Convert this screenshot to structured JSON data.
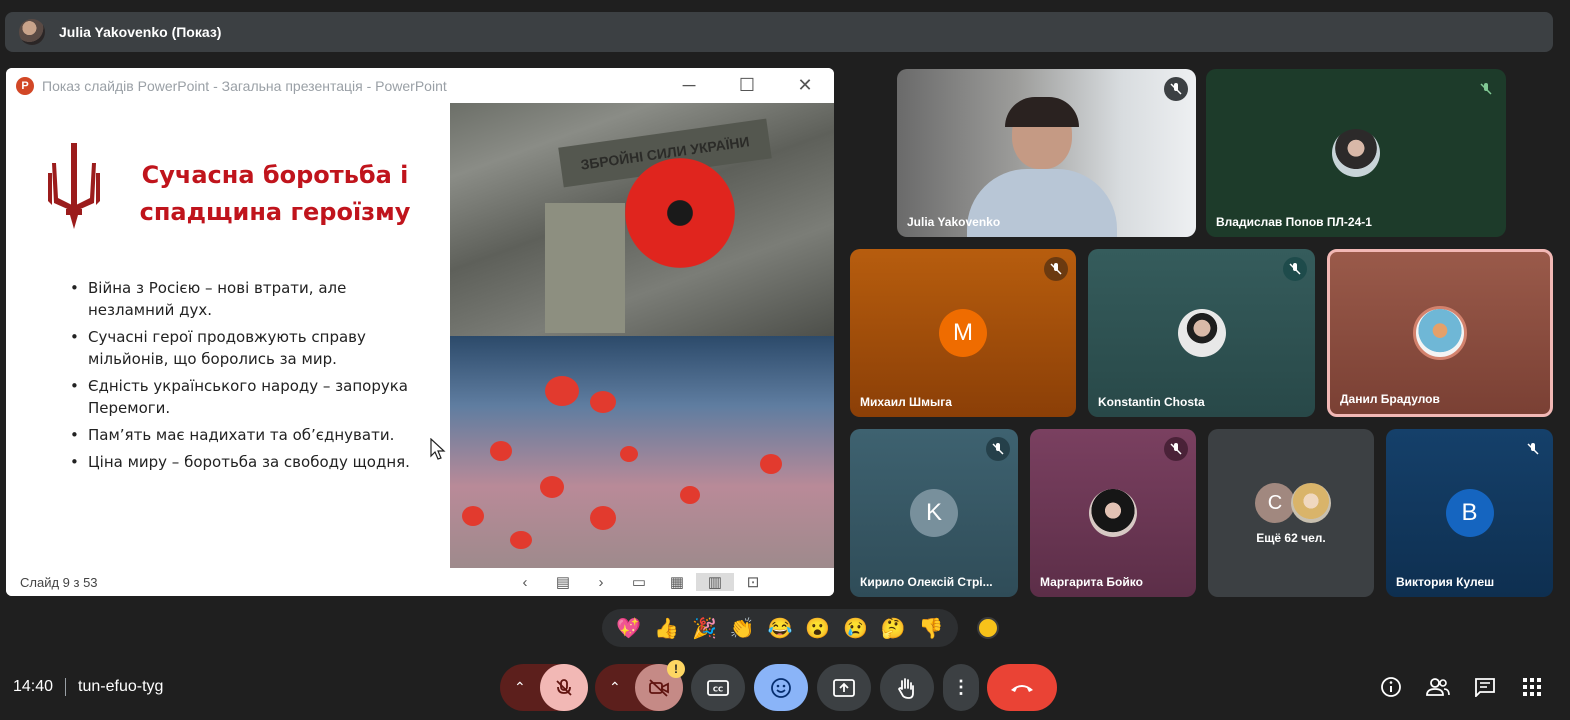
{
  "top_bar": {
    "presenter": "Julia Yakovenko (Показ)"
  },
  "ppt_window": {
    "title": "Показ слайдів PowerPoint  -  Загальна презентація - PowerPoint",
    "app_icon": "P",
    "slide_title": "Сучасна боротьба і спадщина героїзму",
    "bullets": [
      "Війна з Росією – нові втрати, але незламний дух.",
      "Сучасні герої продовжують справу мільйонів, що боролись за мир.",
      "Єдність українського народу – запорука Перемоги.",
      "Пам’ять має надихати та об’єднувати.",
      "Ціна миру – боротьба за свободу щодня."
    ],
    "patch_text": "ЗБРОЙНІ СИЛИ УКРАЇНИ",
    "status": "Слайд 9 з 53"
  },
  "participants": [
    {
      "name": "Julia Yakovenko",
      "initial": ""
    },
    {
      "name": "Владислав Попов ПЛ-24-1",
      "initial": ""
    },
    {
      "name": "Михаил Шмыга",
      "initial": "M"
    },
    {
      "name": "Konstantin Chosta",
      "initial": ""
    },
    {
      "name": "Данил Брадулов",
      "initial": ""
    },
    {
      "name": "Кирило Олексій Стрі...",
      "initial": "K"
    },
    {
      "name": "Маргарита Бойко",
      "initial": ""
    },
    {
      "name": "Ещё 62 чел.",
      "initial": "C"
    },
    {
      "name": "Виктория Кулеш",
      "initial": "B"
    }
  ],
  "reactions": [
    "💖",
    "👍",
    "🎉",
    "👏",
    "😂",
    "😮",
    "😢",
    "🤔",
    "👎"
  ],
  "footer": {
    "time": "14:40",
    "meeting_code": "tun-efuo-tyg",
    "alert_badge": "!"
  },
  "colors": {
    "background": "#1f1f1f",
    "end_call": "#ea4335",
    "muted_button": "#f2b8b5",
    "reactions_active": "#8ab4f8",
    "slide_title": "#c0141c"
  }
}
